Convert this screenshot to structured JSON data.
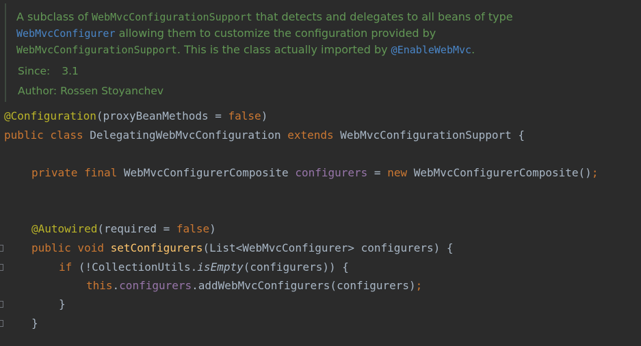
{
  "javadoc": {
    "line1": {
      "text_a": "A subclass of ",
      "code_a": "WebMvcConfigurationSupport",
      "text_b": " that detects and delegates to all beans of type"
    },
    "line2": {
      "link_a": "WebMvcConfigurer",
      "text_a": " allowing them to customize the configuration provided by"
    },
    "line3": {
      "code_a": "WebMvcConfigurationSupport",
      "text_a": ". This is the class actually imported by ",
      "link_a": "@EnableWebMvc",
      "text_b": "."
    },
    "since_label": "Since:",
    "since_value": "3.1",
    "author_label": "Author:",
    "author_value": "Rossen Stoyanchev"
  },
  "code": {
    "l1": {
      "ann": "@Configuration",
      "args": "(proxyBeanMethods = ",
      "val": "false",
      "close": ")"
    },
    "l2": {
      "kw1": "public class ",
      "name": "DelegatingWebMvcConfiguration ",
      "kw2": "extends ",
      "super": "WebMvcConfigurationSupport {"
    },
    "l3": {
      "kw1": "private final ",
      "type": "WebMvcConfigurerComposite ",
      "field": "configurers",
      "eq": " = ",
      "kw2": "new ",
      "ctor": "WebMvcConfigurerComposite()",
      "semi": ";"
    },
    "l4": {
      "ann": "@Autowired",
      "args": "(required = ",
      "val": "false",
      "close": ")"
    },
    "l5": {
      "kw1": "public void ",
      "method": "setConfigurers",
      "params": "(List<WebMvcConfigurer> configurers) {"
    },
    "l6": {
      "kw1": "if ",
      "open": "(!CollectionUtils.",
      "call": "isEmpty",
      "rest": "(configurers)) {"
    },
    "l7": {
      "kw1": "this",
      "dot": ".",
      "field": "configurers",
      "call": ".addWebMvcConfigurers(configurers)",
      "semi": ";"
    },
    "l8": {
      "brace": "}"
    },
    "l9": {
      "brace": "}"
    }
  }
}
